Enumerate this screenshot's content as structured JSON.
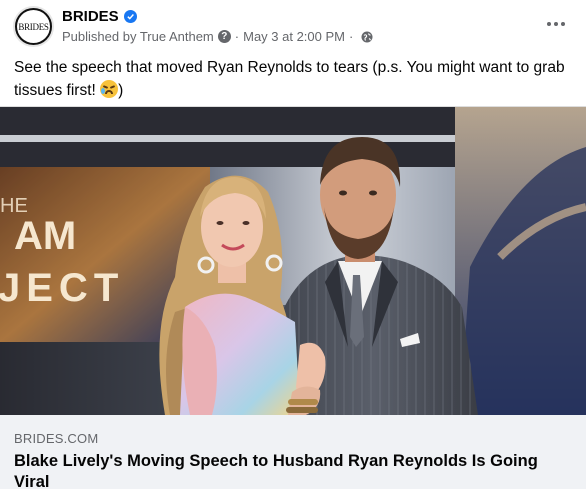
{
  "post": {
    "page_name": "BRIDES",
    "avatar_text": "BRIDES",
    "published_by": "Published by True Anthem",
    "timestamp": "May 3 at 2:00 PM",
    "dot": "·",
    "caption_text": "See the speech that moved Ryan Reynolds to tears (p.s. You might want to grab tissues first! ",
    "caption_end": ")",
    "icons": {
      "verified": "verified-badge-icon",
      "help": "question-circle-icon",
      "audience": "globe-icon",
      "more": "more-options-icon",
      "emoji": "crying-face-emoji"
    },
    "background_text": [
      "HE",
      "AM",
      "JECT"
    ]
  },
  "link": {
    "domain": "BRIDES.COM",
    "headline": "Blake Lively's Moving Speech to Husband Ryan Reynolds Is Going Viral"
  },
  "colors": {
    "accent": "#1877f2",
    "secondary_text": "#65676b",
    "link_bg": "#f0f2f5"
  }
}
